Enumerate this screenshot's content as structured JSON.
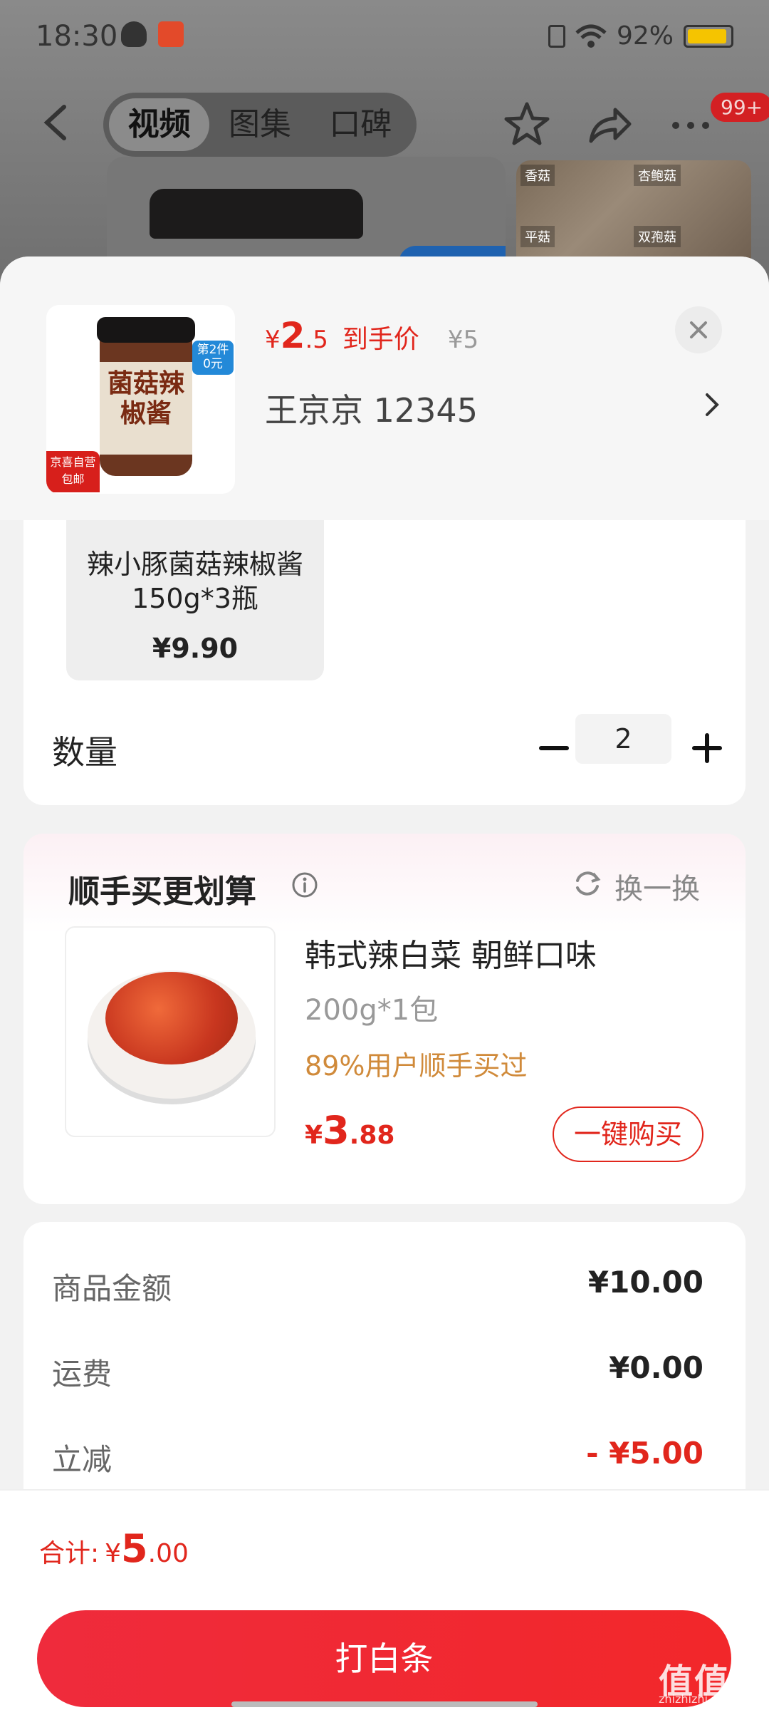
{
  "status_bar": {
    "time": "18:30",
    "battery": "92%"
  },
  "top_nav": {
    "tabs": [
      "视频",
      "图集",
      "口碑"
    ],
    "badge": "99+"
  },
  "thumbnails": {
    "tags": [
      "香菇",
      "杏鲍菇",
      "平菇",
      "双孢菇"
    ]
  },
  "product": {
    "image_text": "菌菇辣椒酱",
    "promo_badge": "第2件 0元",
    "ship_badge": "京喜自营 包邮",
    "price_symbol": "¥",
    "price_int": "2",
    "price_dec": ".5",
    "price_tag": "到手价",
    "original_price": "¥5",
    "address": "王京京  12345"
  },
  "spec": {
    "name": "辣小豚菌菇辣椒酱150g*3瓶",
    "price": "¥9.90"
  },
  "quantity": {
    "label": "数量",
    "value": "2"
  },
  "bundle": {
    "title": "顺手买更划算",
    "refresh_label": "换一换",
    "item_name": "韩式辣白菜 朝鲜口味",
    "item_spec": "200g*1包",
    "item_stat": "89%用户顺手买过",
    "price_symbol": "¥",
    "price_int": "3",
    "price_dec": ".88",
    "buy_label": "一键购买"
  },
  "summary": {
    "rows": [
      {
        "label": "商品金额",
        "value": "¥10.00"
      },
      {
        "label": "运费",
        "value": "¥0.00"
      },
      {
        "label": "立减",
        "value": "- ¥5.00"
      }
    ]
  },
  "footer": {
    "total_label": "合计:",
    "total_symbol": "¥",
    "total_int": "5",
    "total_dec": ".00",
    "pay_label": "打白条"
  },
  "watermark": {
    "main": "值值值",
    "sub": "zhizhizhi.com"
  },
  "colors": {
    "accent_red": "#e1261c",
    "bundle_stat": "#d08a3a",
    "battery": "#f5c400"
  }
}
